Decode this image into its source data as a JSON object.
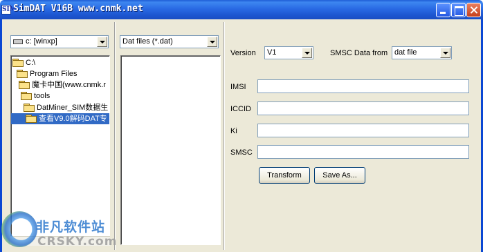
{
  "window": {
    "icon_text": "SIM",
    "title": "SimDAT V16B www.cnmk.net"
  },
  "left_panel": {
    "drive_combo": "c: [winxp]",
    "tree": [
      {
        "label": "C:\\",
        "selected": false
      },
      {
        "label": "Program Files",
        "selected": false
      },
      {
        "label": "魔卡中国(www.cnmk.r",
        "selected": false
      },
      {
        "label": "tools",
        "selected": false
      },
      {
        "label": "DatMiner_SIM数据生",
        "selected": false
      },
      {
        "label": "查看V9.0解码DAT专",
        "selected": true
      }
    ]
  },
  "middle_panel": {
    "filter_combo": "Dat files (*.dat)",
    "files": []
  },
  "right_panel": {
    "version_label": "Version",
    "version_value": "V1",
    "smsc_from_label": "SMSC Data from",
    "smsc_from_value": "dat file",
    "imsi_label": "IMSI",
    "imsi_value": "",
    "iccid_label": "ICCID",
    "iccid_value": "",
    "ki_label": "Ki",
    "ki_value": "",
    "smsc_label": "SMSC",
    "smsc_value": "",
    "transform_label": "Transform",
    "save_as_label": "Save As..."
  },
  "watermark": {
    "cn": "非凡软件站",
    "en": "CRSKY.com"
  },
  "colors": {
    "titlebar": "#2a6ae4",
    "selection": "#316ac5",
    "dialog_bg": "#ece9d8"
  }
}
